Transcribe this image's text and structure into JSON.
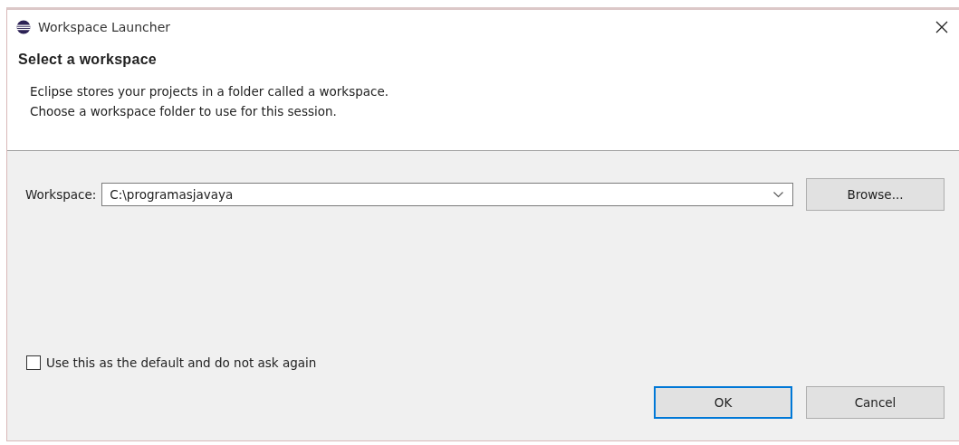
{
  "window": {
    "title": "Workspace Launcher"
  },
  "header": {
    "title": "Select a workspace",
    "description": [
      "Eclipse stores your projects in a folder called a workspace.",
      "Choose a workspace folder to use for this session."
    ]
  },
  "workspace": {
    "label": "Workspace:",
    "value": "C:\\programasjavaya",
    "browse_button": "Browse..."
  },
  "default_checkbox": {
    "label": "Use this as the default and do not ask again",
    "checked": false
  },
  "buttons": [
    {
      "label": "OK",
      "default": true
    },
    {
      "label": "Cancel",
      "default": false
    }
  ]
}
